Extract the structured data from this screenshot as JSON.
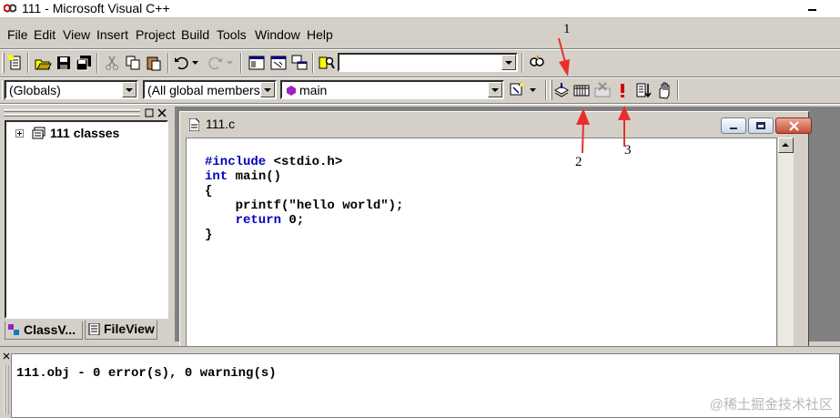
{
  "window": {
    "title": "111 - Microsoft Visual C++"
  },
  "menu": [
    "File",
    "Edit",
    "View",
    "Insert",
    "Project",
    "Build",
    "Tools",
    "Window",
    "Help"
  ],
  "toolbar": {
    "find_combo_value": "",
    "scope_combo": "(Globals)",
    "members_combo": "(All global members",
    "function_combo": "main",
    "icons": [
      "new-text-file-icon",
      "open-icon",
      "save-icon",
      "save-all-icon",
      "cut-icon",
      "copy-icon",
      "paste-icon",
      "undo-icon",
      "redo-icon",
      "workspace-icon",
      "output-icon",
      "window-list-icon",
      "find-in-files-icon",
      "find-icon",
      "wizard-action-icon",
      "compile-icon",
      "build-icon",
      "stop-build-icon",
      "execute-icon",
      "go-icon",
      "breakpoint-icon"
    ]
  },
  "workspace": {
    "tree_root": "111 classes",
    "tabs": [
      "ClassV...",
      "FileView"
    ]
  },
  "editor": {
    "tab_title": "111.c",
    "code_lines": [
      [
        "#include",
        " <stdio.h>"
      ],
      [
        "int",
        " main()"
      ],
      [
        "",
        "{"
      ],
      [
        "",
        "    printf(\"hello world\");"
      ],
      [
        "    return",
        " 0;"
      ],
      [
        "",
        "}"
      ]
    ]
  },
  "output": {
    "text": "111.obj - 0 error(s), 0 warning(s)"
  },
  "annotations": [
    "1",
    "2",
    "3"
  ],
  "watermark": "@稀土掘金技术社区",
  "colors": {
    "keyword": "#0000c0",
    "annotation_arrow": "#e8302a",
    "window_bg": "#d4d0c8"
  }
}
